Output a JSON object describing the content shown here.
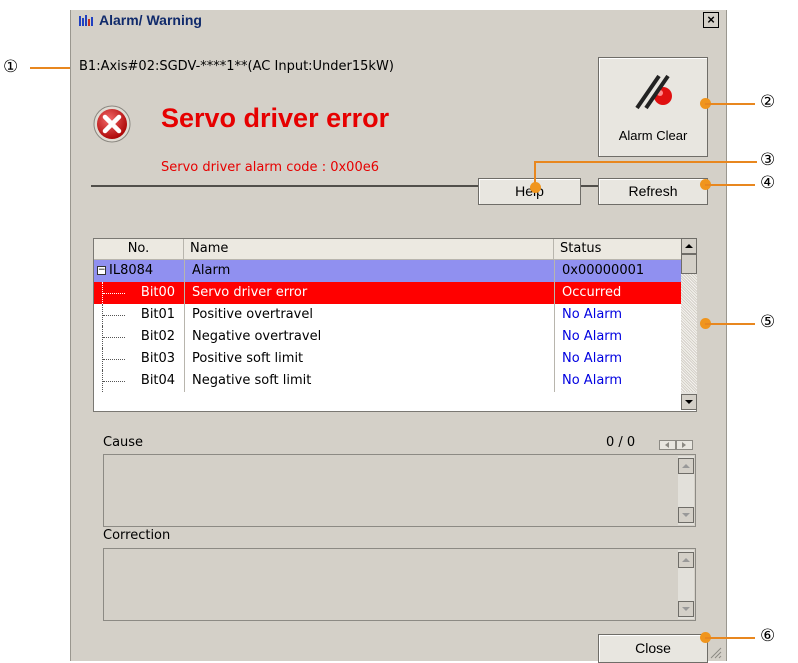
{
  "window": {
    "title": "Alarm/ Warning",
    "close_glyph": "×",
    "axis_info": "B1:Axis#02:SGDV-****1**(AC Input:Under15kW)",
    "error_title": "Servo driver error",
    "alarm_code": "Servo driver alarm code : 0x00e6"
  },
  "buttons": {
    "alarm_clear": "Alarm Clear",
    "help": "Help",
    "refresh": "Refresh",
    "close": "Close"
  },
  "table": {
    "columns": [
      "No.",
      "Name",
      "Status"
    ],
    "group": {
      "no": "IL8084",
      "name": "Alarm",
      "status": "0x00000001",
      "expander": "−"
    },
    "rows": [
      {
        "no": "Bit00",
        "name": "Servo driver error",
        "status": "Occurred"
      },
      {
        "no": "Bit01",
        "name": "Positive overtravel",
        "status": "No Alarm"
      },
      {
        "no": "Bit02",
        "name": "Negative overtravel",
        "status": "No Alarm"
      },
      {
        "no": "Bit03",
        "name": "Positive soft limit",
        "status": "No Alarm"
      },
      {
        "no": "Bit04",
        "name": "Negative soft limit",
        "status": "No Alarm"
      }
    ]
  },
  "cause": {
    "label": "Cause",
    "counter": "0 / 0"
  },
  "correction": {
    "label": "Correction"
  },
  "callouts": [
    "①",
    "②",
    "③",
    "④",
    "⑤",
    "⑥"
  ],
  "colors": {
    "error_red": "#e60000",
    "selected_row": "#ff0000",
    "group_row": "#9090f0",
    "no_alarm_blue": "#0000e0",
    "callout_orange": "#f0951d"
  },
  "icons": [
    "app-icon",
    "error-icon",
    "alarm-clear-icon",
    "close-icon",
    "scroll-up-icon",
    "scroll-down-icon"
  ]
}
